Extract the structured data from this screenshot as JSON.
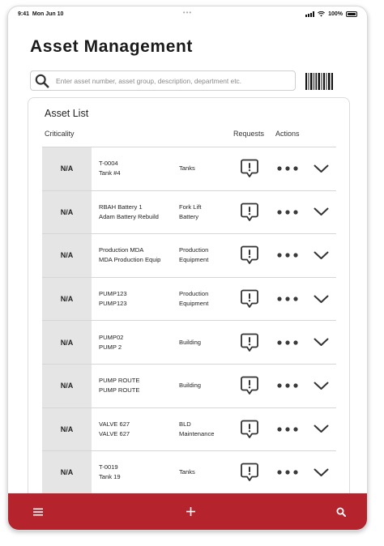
{
  "status_bar": {
    "time": "9:41",
    "date": "Mon Jun 10",
    "battery": "100%"
  },
  "page": {
    "title": "Asset Management"
  },
  "search": {
    "placeholder": "Enter asset number, asset group, description, department etc."
  },
  "asset_list": {
    "title": "Asset List",
    "columns": {
      "criticality": "Criticality",
      "requests": "Requests",
      "actions": "Actions"
    },
    "rows": [
      {
        "criticality": "N/A",
        "asset_line1": "T-0004",
        "asset_line2": "Tank #4",
        "dept_line1": "Tanks",
        "dept_line2": ""
      },
      {
        "criticality": "N/A",
        "asset_line1": "RBAH Battery 1",
        "asset_line2": "Adam Battery Rebuild",
        "dept_line1": "Fork Lift",
        "dept_line2": "Battery"
      },
      {
        "criticality": "N/A",
        "asset_line1": "Production MDA",
        "asset_line2": "MDA Production Equip",
        "dept_line1": "Production",
        "dept_line2": "Equipment"
      },
      {
        "criticality": "N/A",
        "asset_line1": "PUMP123",
        "asset_line2": "PUMP123",
        "dept_line1": "Production",
        "dept_line2": "Equipment"
      },
      {
        "criticality": "N/A",
        "asset_line1": "PUMP02",
        "asset_line2": "PUMP 2",
        "dept_line1": "Building",
        "dept_line2": ""
      },
      {
        "criticality": "N/A",
        "asset_line1": "PUMP ROUTE",
        "asset_line2": "PUMP ROUTE",
        "dept_line1": "Building",
        "dept_line2": ""
      },
      {
        "criticality": "N/A",
        "asset_line1": "VALVE 627",
        "asset_line2": "VALVE 627",
        "dept_line1": "BLD",
        "dept_line2": "Maintenance"
      },
      {
        "criticality": "N/A",
        "asset_line1": "T-0019",
        "asset_line2": "Tank 19",
        "dept_line1": "Tanks",
        "dept_line2": ""
      }
    ]
  },
  "bottom_bar": {
    "color": "#b5232c",
    "icons": [
      "menu-icon",
      "plus-icon",
      "search-icon"
    ]
  },
  "icons": {
    "search": "search-icon",
    "barcode": "barcode-icon",
    "request": "request-alert-icon",
    "more": "more-horizontal-icon",
    "expand": "chevron-down-icon"
  }
}
